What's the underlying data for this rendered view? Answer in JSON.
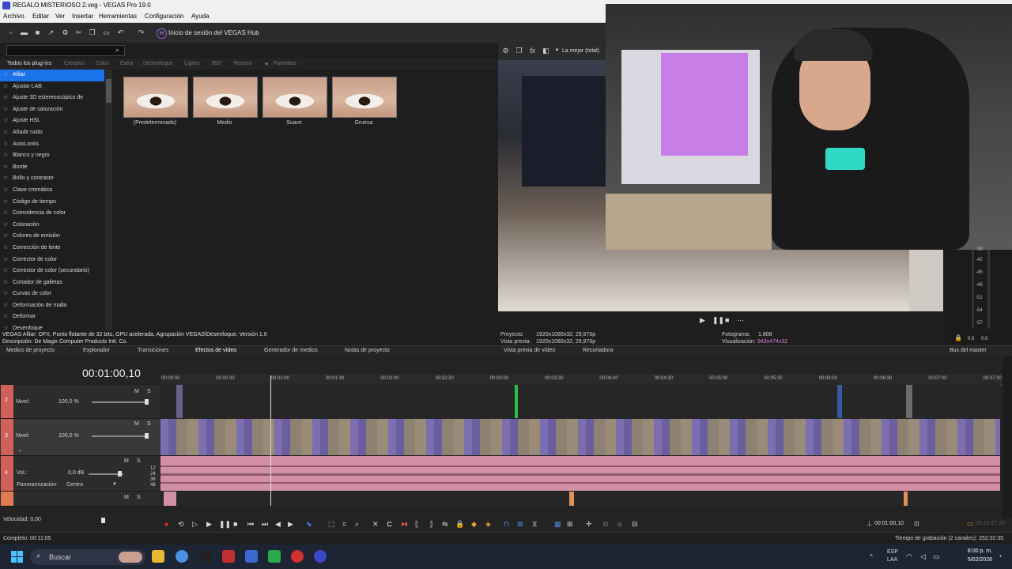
{
  "window": {
    "title": "REGALO MISTERIOSO 2.veg - VEGAS Pro 19.0"
  },
  "menu": [
    "Archivo",
    "Editar",
    "Ver",
    "Insertar",
    "Herramientas",
    "Configuración",
    "Ayuda"
  ],
  "toolbar": {
    "hub_label": "Inicio de sesión del VEGAS Hub"
  },
  "plugins": {
    "tabs": [
      "Todos los plug-ins",
      "Creativo",
      "Color",
      "Extra",
      "Desenfoque",
      "Ligero",
      "360°",
      "Tercero",
      "Favoritos"
    ],
    "items": [
      "Afilar",
      "Ajustar LAB",
      "Ajuste 3D estereoscópico de",
      "Ajuste de saturación",
      "Ajuste HSL",
      "Añadir ruido",
      "AutoLooks",
      "Blanco y negro",
      "Borde",
      "Brillo y contraste",
      "Clave cromática",
      "Código de tiempo",
      "Coincidencia de color",
      "Coloración",
      "Colores de emisión",
      "Corrección de lente",
      "Corrector de color",
      "Corrector de color (secundario)",
      "Cortador de galletas",
      "Curvas de color",
      "Deformación de malla",
      "Deformar",
      "Desenfoque"
    ],
    "presets": [
      "(Predeterminado)",
      "Medio",
      "Suave",
      "Gruesa"
    ],
    "description_line1": "VEGAS Afilar: OFX, Punto flotante de 32 bits, GPU acelerada, Agrupación VEGAS\\Desenfoque, Versión 1.0",
    "description_line2": "Descripción: De Magix Computer Products Intl. Co."
  },
  "preview": {
    "quality": "La mejor (total)",
    "proyecto_label": "Proyecto:",
    "proyecto_value": "1920x1080x32; 29,970p",
    "vista_label": "Vista previa:",
    "vista_value": "1920x1080x32; 29,970p",
    "fotograma_label": "Fotograma:",
    "fotograma_value": "1.808",
    "visualizacion_label": "Visualización:",
    "visualizacion_value": "843x474x32"
  },
  "meter": {
    "scale": [
      "-39",
      "-42",
      "-45",
      "-48",
      "-51",
      "-54",
      "-57"
    ],
    "left": "0.0",
    "right": "0.0"
  },
  "panel_tabs": [
    "Medios de proyecto",
    "Explorador",
    "Transiciones",
    "Efectos de vídeo",
    "Generador de medios",
    "Notas de proyecto",
    "Vista previa de vídeo",
    "Recortadora",
    "Bus del master"
  ],
  "timeline": {
    "timecode": "00:01:00,10",
    "ruler": [
      "00:00:00",
      "00:00:30",
      "00:01:00",
      "00:01:30",
      "00:02:00",
      "00:02:30",
      "00:03:00",
      "00:03:30",
      "00:04:00",
      "00:04:30",
      "00:05:00",
      "00:05:30",
      "00:06:00",
      "00:06:30",
      "00:07:00",
      "00:07:30"
    ],
    "tracks": [
      {
        "num": "2",
        "label": "Nivel:",
        "value": "100,0 %"
      },
      {
        "num": "3",
        "label": "Nivel:",
        "value": "100,0 %"
      },
      {
        "num": "4",
        "label": "Vol.:",
        "value": "0,0 dB",
        "pan_label": "Panoramización:",
        "pan_value": "Centro"
      }
    ],
    "speed_label": "Velocidad: 0,00",
    "cursor_time": "00:01:00,10",
    "end_time": "00:15:27,20",
    "db_scale": [
      "12",
      "24",
      "36",
      "48"
    ],
    "mute": "M",
    "solo": "S"
  },
  "status": {
    "left": "Completo: 00:11:05",
    "right": "Tiempo de grabación (2 canales): 252:02:35"
  },
  "taskbar": {
    "search": "Buscar",
    "lang1": "ESP",
    "lang2": "LAA",
    "time": "8:00 p. m.",
    "date": "5/02/2026"
  },
  "colors": {
    "accent": "#1a73e8",
    "audio_clip": "#d38fa6",
    "video_clip": "#7b6fb0",
    "track_tag": "#d0605a"
  }
}
